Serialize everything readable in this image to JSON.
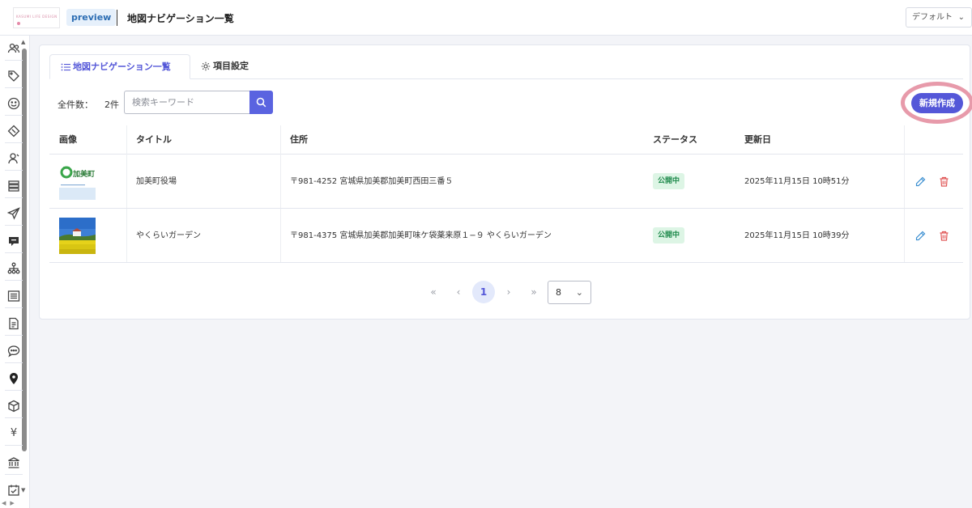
{
  "header": {
    "logo_text": "KASUMI LIFE DESIGN",
    "env_badge": "preview",
    "page_title": "地図ナビゲーション一覧",
    "display_select": "デフォルト"
  },
  "sidebar": {
    "items": [
      "users-icon",
      "tag-icon",
      "smile-icon",
      "ticket-icon",
      "user-icon",
      "layers-icon",
      "send-icon",
      "chat-bubble-icon",
      "sitemap-icon",
      "list-icon",
      "document-icon",
      "comment-icon",
      "map-pin-icon",
      "box-icon",
      "yen-icon",
      "bank-icon",
      "calendar-check-icon"
    ]
  },
  "tabs": [
    {
      "label": "地図ナビゲーション一覧",
      "active": true,
      "icon": "list-icon"
    },
    {
      "label": "項目設定",
      "active": false,
      "icon": "gear-icon"
    }
  ],
  "toolbar": {
    "count_label": "全件数：",
    "count_value": "2件",
    "search_placeholder": "検索キーワード",
    "new_button": "新規作成"
  },
  "table": {
    "columns": [
      "画像",
      "タイトル",
      "住所",
      "ステータス",
      "更新日"
    ],
    "rows": [
      {
        "image_alt": "加美町",
        "image_text": "加美町",
        "title": "加美町役場",
        "address": "〒981-4252 宮城県加美郡加美町西田三番５",
        "status": "公開中",
        "updated": "2025年11月15日 10時51分"
      },
      {
        "image_alt": "yellow flower field",
        "title": "やくらいガーデン",
        "address": "〒981-4375 宮城県加美郡加美町味ケ袋薬来原１−９ やくらいガーデン",
        "status": "公開中",
        "updated": "2025年11月15日 10時39分"
      }
    ]
  },
  "pagination": {
    "first": "«",
    "prev": "‹",
    "current": "1",
    "next": "›",
    "last": "»",
    "per_page": "8"
  },
  "colors": {
    "accent": "#5457d8",
    "status_green_bg": "#ddf5e5",
    "status_green_text": "#1f8a4c",
    "edit": "#3b8fd1",
    "delete": "#e05757",
    "highlight_ring": "#e79aaa"
  }
}
